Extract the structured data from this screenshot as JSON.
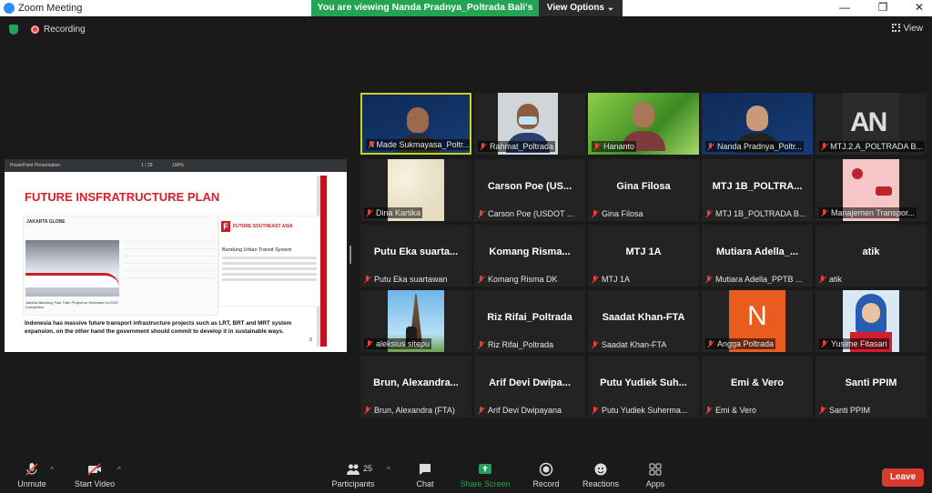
{
  "window": {
    "title": "Zoom Meeting",
    "minimize": "—",
    "restore": "❐",
    "close": "✕"
  },
  "banner": {
    "viewing": "You are viewing Nanda Pradnya_Poltrada Bali's screen",
    "view_options": "View Options ⌄"
  },
  "status": {
    "recording": "Recording",
    "view": "View"
  },
  "shared_screen": {
    "toolbar_title": "PowerPoint Presentation",
    "toolbar_page": "1 / 29",
    "toolbar_zoom": "100%",
    "slide_title": "FUTURE INSFRATRUCTURE PLAN",
    "jakarta_logo": "JAKARTA GLOBE",
    "news_caption": "Jakarta-Bandung Fast Train Project on Schedule for 2021 Completion",
    "fsa_logo": "F",
    "fsa_name": "FUTURE SOUTHEAST ASIA",
    "fsa_article_title": "Bandung Urban Transit System",
    "slide_text": "Indonesia has massive future transport infrastructure projects such as LRT, BRT and MRT system expansion, on the other hand the government should commit to develop it in sustainable ways.",
    "page_number": "6"
  },
  "participants": [
    {
      "label": "I Made Sukmayasa_Poltr...",
      "big": "",
      "pic": "ppt-man",
      "active": true
    },
    {
      "label": "Rahmat_Poltrada",
      "big": "",
      "pic": "mask-man",
      "active": false
    },
    {
      "label": "Hananto",
      "big": "",
      "pic": "greenery",
      "active": false
    },
    {
      "label": "Nanda Pradnya_Poltr...",
      "big": "",
      "pic": "ppt-woman",
      "active": false
    },
    {
      "label": "MTJ.2.A_POLTRADA B...",
      "big": "",
      "pic": "an",
      "active": false
    },
    {
      "label": "Dina Kartika",
      "big": "",
      "pic": "flowers",
      "active": false
    },
    {
      "label": "Carson Poe (USDOT ...",
      "big": "Carson Poe (US...",
      "pic": "",
      "active": false
    },
    {
      "label": "Gina Filosa",
      "big": "Gina Filosa",
      "pic": "",
      "active": false
    },
    {
      "label": "MTJ 1B_POLTRADA B...",
      "big": "MTJ 1B_POLTRA...",
      "pic": "",
      "active": false
    },
    {
      "label": "Manajemen Transpor...",
      "big": "",
      "pic": "transport",
      "active": false
    },
    {
      "label": "Putu Eka suartawan",
      "big": "Putu Eka suarta...",
      "pic": "",
      "active": false
    },
    {
      "label": "Komang Risma DK",
      "big": "Komang Risma...",
      "pic": "",
      "active": false
    },
    {
      "label": "MTJ 1A",
      "big": "MTJ 1A",
      "pic": "",
      "active": false
    },
    {
      "label": "Mutiara Adella_PPTB ...",
      "big": "Mutiara Adella_...",
      "pic": "",
      "active": false
    },
    {
      "label": "atik",
      "big": "atik",
      "pic": "",
      "active": false
    },
    {
      "label": "aleksius sitepu",
      "big": "",
      "pic": "tower",
      "active": false
    },
    {
      "label": "Riz Rifai_Poltrada",
      "big": "Riz Rifai_Poltrada",
      "pic": "",
      "active": false
    },
    {
      "label": "Saadat Khan-FTA",
      "big": "Saadat Khan-FTA",
      "pic": "",
      "active": false
    },
    {
      "label": "Angga Poltrada",
      "big": "",
      "pic": "n",
      "active": false
    },
    {
      "label": "Yusime Fitasari",
      "big": "",
      "pic": "hijab",
      "active": false
    },
    {
      "label": "Brun, Alexandra (FTA)",
      "big": "Brun, Alexandra...",
      "pic": "",
      "active": false
    },
    {
      "label": "Arif Devi Dwipayana",
      "big": "Arif Devi Dwipa...",
      "pic": "",
      "active": false
    },
    {
      "label": "Putu Yudiek Suherma...",
      "big": "Putu Yudiek Suh...",
      "pic": "",
      "active": false
    },
    {
      "label": "Emi & Vero",
      "big": "Emi & Vero",
      "pic": "",
      "active": false
    },
    {
      "label": "Santi PPIM",
      "big": "Santi PPIM",
      "pic": "",
      "active": false
    }
  ],
  "toolbar": {
    "unmute": "Unmute",
    "start_video": "Start Video",
    "participants": "Participants",
    "participants_count": "25",
    "chat": "Chat",
    "share_screen": "Share Screen",
    "record": "Record",
    "reactions": "Reactions",
    "apps": "Apps",
    "leave": "Leave"
  },
  "colors": {
    "accent_green": "#23a455",
    "leave_red": "#d93a2f",
    "active_speaker": "#c7d418"
  }
}
